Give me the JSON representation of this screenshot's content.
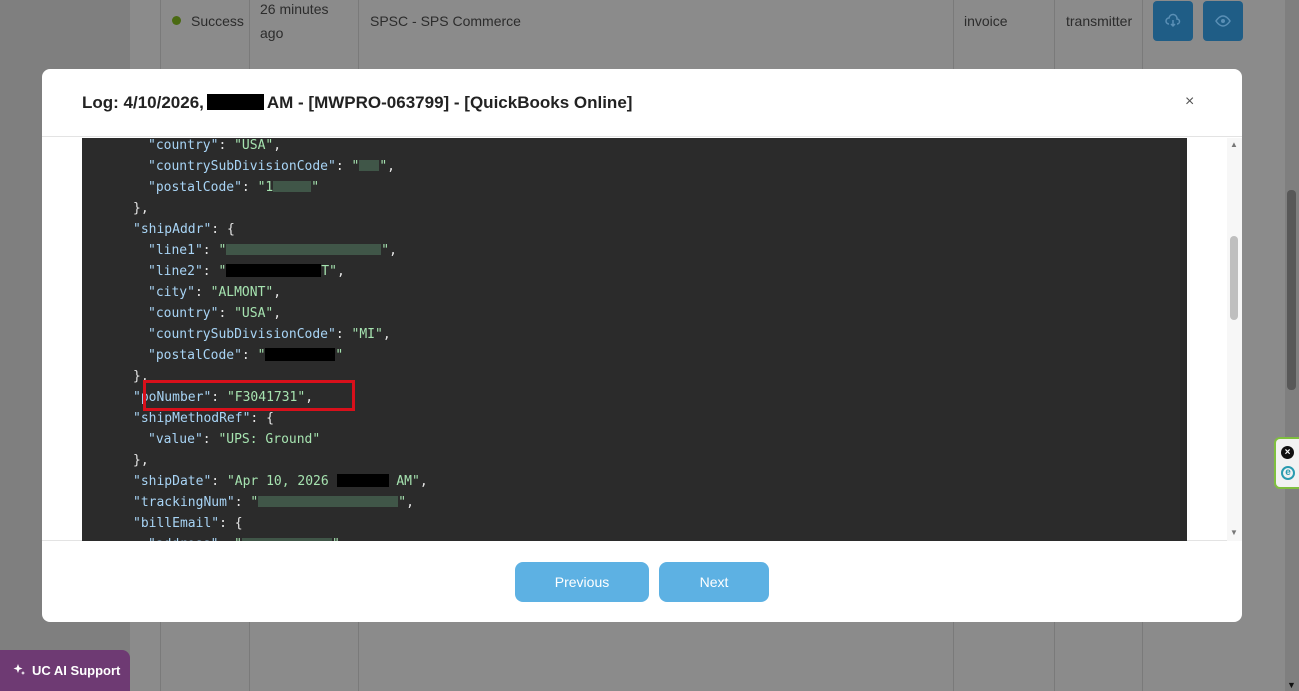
{
  "background_row": {
    "status": "Success",
    "time_line1": "26 minutes",
    "time_line2": "ago",
    "partner": "SPSC - SPS Commerce",
    "doc_type": "invoice",
    "direction": "transmitter"
  },
  "support": {
    "label": "UC AI Support"
  },
  "modal": {
    "title_prefix": "Log: 4/10/2026,",
    "title_suffix": "AM - [MWPRO-063799] - [QuickBooks Online]",
    "close_glyph": "×",
    "lines": [
      {
        "indent": 2,
        "key": "\"country\"",
        "sep": ": ",
        "val": "\"USA\"",
        "tail": ","
      },
      {
        "indent": 2,
        "key": "\"countrySubDivisionCode\"",
        "sep": ": ",
        "val": "\"",
        "blur": 20,
        "val2": "\"",
        "tail": ","
      },
      {
        "indent": 2,
        "key": "\"postalCode\"",
        "sep": ": ",
        "val": "\"1",
        "blur": 38,
        "val2": "\"",
        "tail": ""
      },
      {
        "indent": 1,
        "punct": "},"
      },
      {
        "indent": 1,
        "key": "\"shipAddr\"",
        "sep": ": ",
        "punct2": "{"
      },
      {
        "indent": 2,
        "key": "\"line1\"",
        "sep": ": ",
        "val": "\"",
        "blur": 155,
        "val2": "\"",
        "tail": ","
      },
      {
        "indent": 2,
        "key": "\"line2\"",
        "sep": ": ",
        "val": "\"",
        "black": 95,
        "val2": "T\"",
        "tail": ","
      },
      {
        "indent": 2,
        "key": "\"city\"",
        "sep": ": ",
        "val": "\"ALMONT\"",
        "tail": ","
      },
      {
        "indent": 2,
        "key": "\"country\"",
        "sep": ": ",
        "val": "\"USA\"",
        "tail": ","
      },
      {
        "indent": 2,
        "key": "\"countrySubDivisionCode\"",
        "sep": ": ",
        "val": "\"MI\"",
        "tail": ","
      },
      {
        "indent": 2,
        "key": "\"postalCode\"",
        "sep": ": ",
        "val": "\"",
        "black": 70,
        "val2": "\"",
        "tail": ""
      },
      {
        "indent": 1,
        "punct": "},"
      },
      {
        "indent": 1,
        "key": "\"poNumber\"",
        "sep": ": ",
        "val": "\"F3041731\"",
        "tail": ","
      },
      {
        "indent": 1,
        "key": "\"shipMethodRef\"",
        "sep": ": ",
        "punct2": "{"
      },
      {
        "indent": 2,
        "key": "\"value\"",
        "sep": ": ",
        "val": "\"UPS: Ground\"",
        "tail": ""
      },
      {
        "indent": 1,
        "punct": "},"
      },
      {
        "indent": 1,
        "key": "\"shipDate\"",
        "sep": ": ",
        "val": "\"Apr 10, 2026 ",
        "black": 52,
        "val2": " AM\"",
        "tail": ","
      },
      {
        "indent": 1,
        "key": "\"trackingNum\"",
        "sep": ": ",
        "val": "\"",
        "blur": 140,
        "val2": "\"",
        "tail": ","
      },
      {
        "indent": 1,
        "key": "\"billEmail\"",
        "sep": ": ",
        "punct2": "{"
      },
      {
        "indent": 2,
        "key": "\"address\"",
        "sep": ": ",
        "val": "\"",
        "blur": 90,
        "val2": "\"",
        "tail": ""
      }
    ]
  },
  "buttons": {
    "previous": "Previous",
    "next": "Next"
  },
  "colors": {
    "primary_button": "#5db1e3",
    "highlight": "#d8101b",
    "code_bg": "#2b2b2b"
  }
}
